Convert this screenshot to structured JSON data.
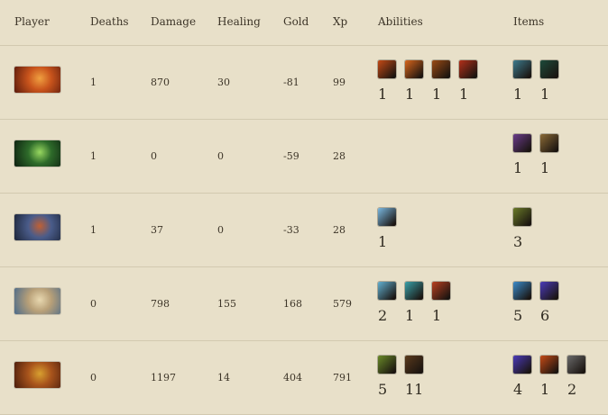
{
  "headers": {
    "player": "Player",
    "deaths": "Deaths",
    "damage": "Damage",
    "healing": "Healing",
    "gold": "Gold",
    "xp": "Xp",
    "abilities": "Abilities",
    "items": "Items"
  },
  "rows": [
    {
      "hero_icon": "hero-portrait-fiery-warrior",
      "portrait_colors": [
        "#5a1a0c",
        "#c9541c",
        "#f0a040"
      ],
      "deaths": "1",
      "damage": "870",
      "healing": "30",
      "gold": "-81",
      "xp": "99",
      "abilities": [
        {
          "icon": "fire-fist-ability-icon",
          "color": "#c44a16",
          "count": "1"
        },
        {
          "icon": "flame-spear-ability-icon",
          "color": "#d8661c",
          "count": "1"
        },
        {
          "icon": "burning-slash-ability-icon",
          "color": "#9a4a14",
          "count": "1"
        },
        {
          "icon": "explosion-ability-icon",
          "color": "#b3301a",
          "count": "1"
        }
      ],
      "items": [
        {
          "icon": "frost-orb-item-icon",
          "color": "#3d7a8c",
          "count": "1"
        },
        {
          "icon": "green-wand-item-icon",
          "color": "#1d4a3a",
          "count": "1"
        }
      ]
    },
    {
      "hero_icon": "hero-portrait-green-mask",
      "portrait_colors": [
        "#0d1f10",
        "#2e6b2a",
        "#98d860"
      ],
      "deaths": "1",
      "damage": "0",
      "healing": "0",
      "gold": "-59",
      "xp": "28",
      "abilities": [],
      "items": [
        {
          "icon": "purple-dagger-item-icon",
          "color": "#6a3c8a",
          "count": "1"
        },
        {
          "icon": "scroll-item-icon",
          "color": "#8a6a36",
          "count": "1"
        }
      ]
    },
    {
      "hero_icon": "hero-portrait-armored-brute",
      "portrait_colors": [
        "#1c2538",
        "#4a5c8a",
        "#c06034"
      ],
      "deaths": "1",
      "damage": "37",
      "healing": "0",
      "gold": "-33",
      "xp": "28",
      "abilities": [
        {
          "icon": "ice-shard-ability-icon",
          "color": "#7ab8e0",
          "count": "1"
        }
      ],
      "items": [
        {
          "icon": "gold-gauntlet-item-icon",
          "color": "#6a7a28",
          "count": "3"
        }
      ]
    },
    {
      "hero_icon": "hero-portrait-dwarf-gunner",
      "portrait_colors": [
        "#4a6a8a",
        "#b8a078",
        "#e8d8b0"
      ],
      "deaths": "0",
      "damage": "798",
      "healing": "155",
      "gold": "168",
      "xp": "579",
      "abilities": [
        {
          "icon": "ice-blast-ability-icon",
          "color": "#62b0d0",
          "count": "2"
        },
        {
          "icon": "spectral-figure-ability-icon",
          "color": "#3aa0a8",
          "count": "1"
        },
        {
          "icon": "flame-burst-ability-icon",
          "color": "#b84020",
          "count": "1"
        }
      ],
      "items": [
        {
          "icon": "blue-potion-item-icon",
          "color": "#3a8ac8",
          "count": "5"
        },
        {
          "icon": "mana-staff-item-icon",
          "color": "#4a3ab8",
          "count": "6"
        }
      ]
    },
    {
      "hero_icon": "hero-portrait-beast-rider",
      "portrait_colors": [
        "#4a1c0c",
        "#a8541c",
        "#d8a030"
      ],
      "deaths": "0",
      "damage": "1197",
      "healing": "14",
      "gold": "404",
      "xp": "791",
      "abilities": [
        {
          "icon": "green-beast-ability-icon",
          "color": "#6a8a28",
          "count": "5"
        },
        {
          "icon": "claw-strike-ability-icon",
          "color": "#5a3a1c",
          "count": "11"
        }
      ],
      "items": [
        {
          "icon": "mana-staff-item-icon",
          "color": "#4a3ab8",
          "count": "4"
        },
        {
          "icon": "fire-blade-item-icon",
          "color": "#c44a16",
          "count": "1"
        },
        {
          "icon": "battle-axe-item-icon",
          "color": "#6a6a6a",
          "count": "2"
        }
      ]
    }
  ]
}
